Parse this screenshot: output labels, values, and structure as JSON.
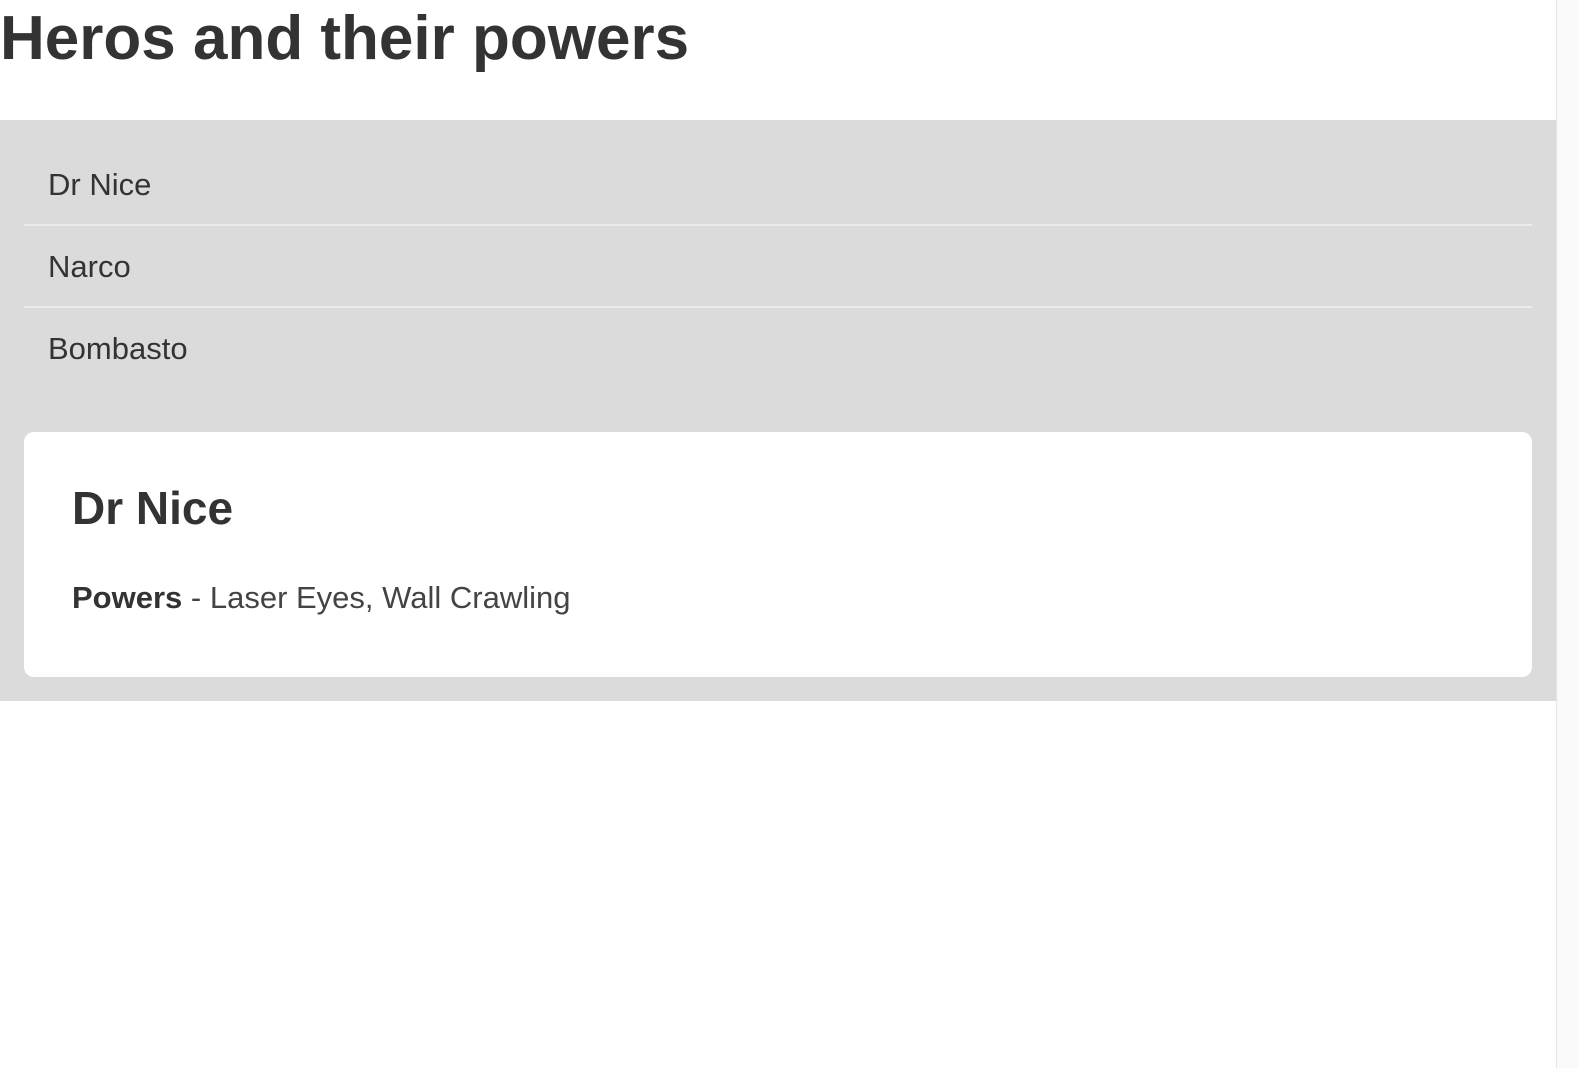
{
  "page": {
    "title": "Heros and their powers"
  },
  "heroes": {
    "items": [
      {
        "name": "Dr Nice"
      },
      {
        "name": "Narco"
      },
      {
        "name": "Bombasto"
      }
    ]
  },
  "detail": {
    "name": "Dr Nice",
    "powers_label": "Powers",
    "powers_separator": " - ",
    "powers_value": "Laser Eyes, Wall Crawling"
  },
  "colors": {
    "panel_bg": "#dbdbdb",
    "card_bg": "#ffffff",
    "text": "#333333",
    "divider": "#ececec"
  }
}
